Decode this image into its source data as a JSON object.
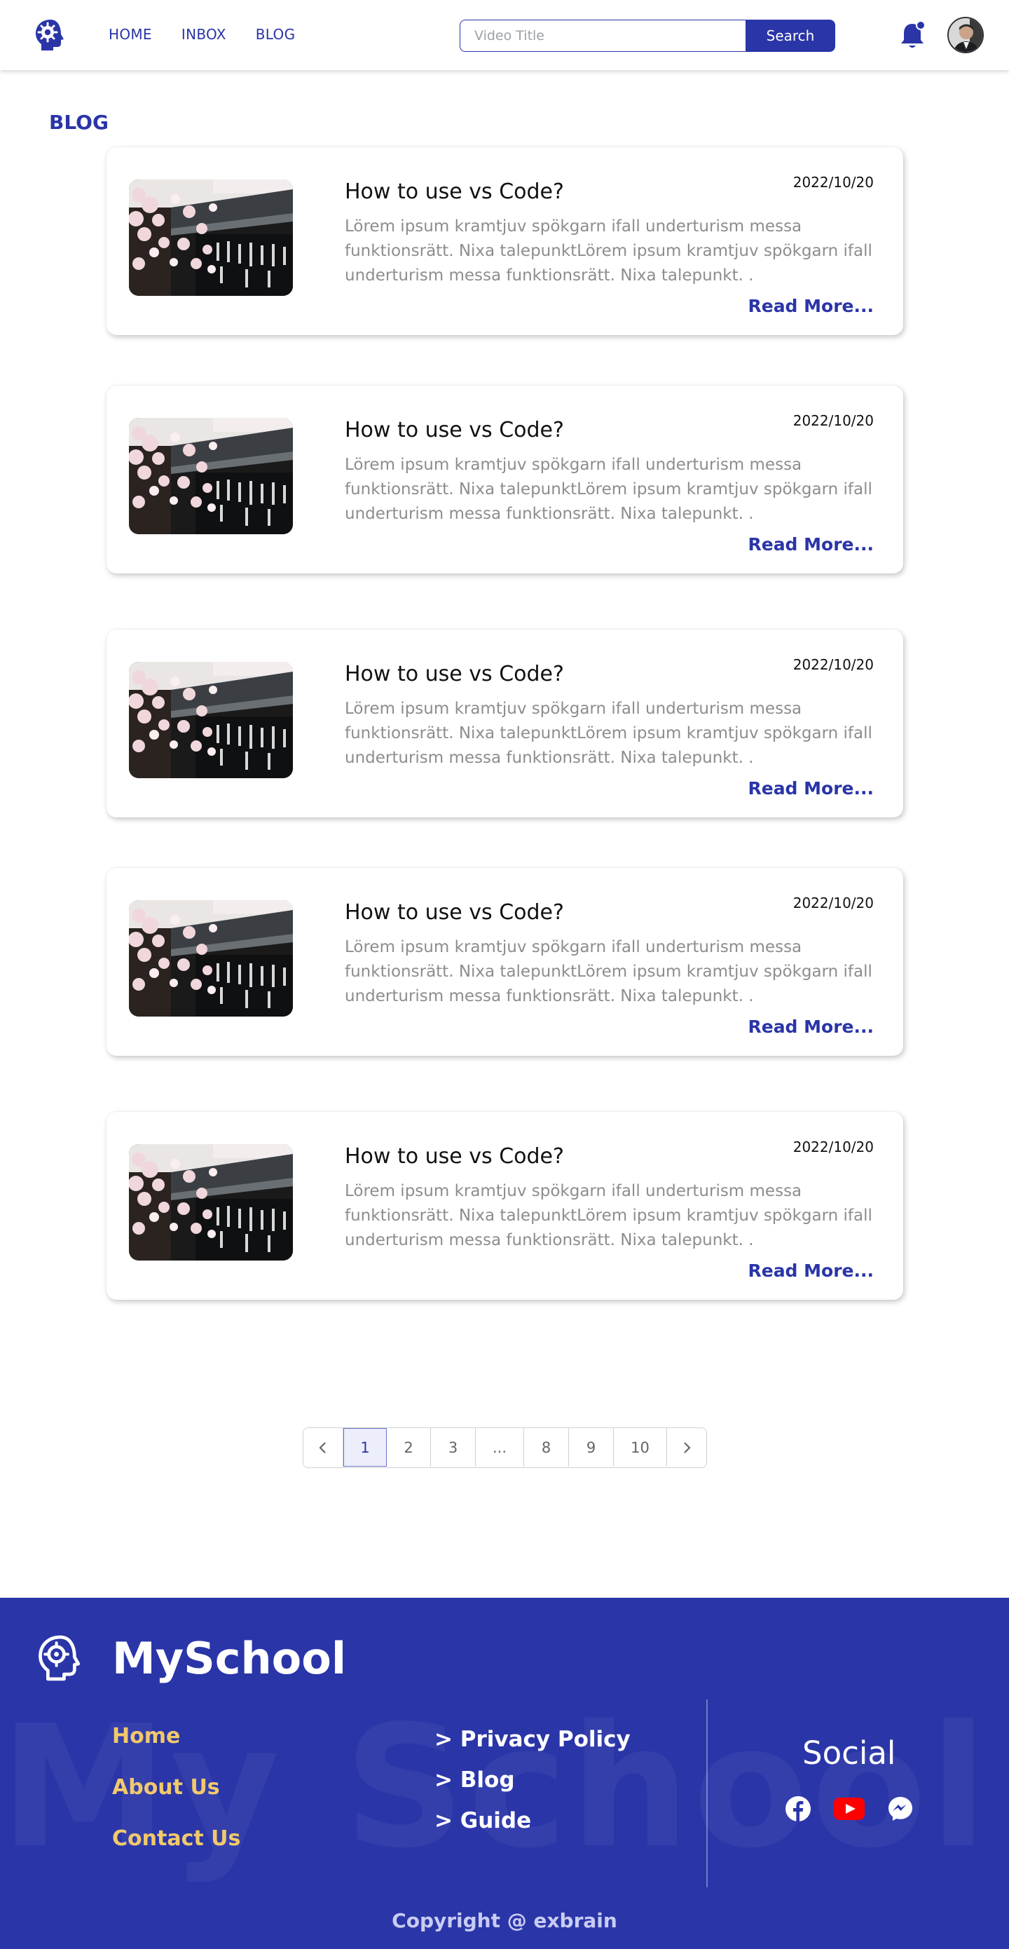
{
  "header": {
    "nav": [
      "HOME",
      "INBOX",
      "BLOG"
    ],
    "search_placeholder": "Video Title",
    "search_label": "Search"
  },
  "page": {
    "title": "BLOG"
  },
  "posts": [
    {
      "title": "How to use vs Code?",
      "date": "2022/10/20",
      "excerpt": "Lörem ipsum kramtjuv spökgarn ifall underturism messa funktionsrätt. Nixa talepunktLörem ipsum kramtjuv spökgarn ifall underturism messa funktionsrätt. Nixa talepunkt. .",
      "more": "Read More..."
    },
    {
      "title": "How to use vs Code?",
      "date": "2022/10/20",
      "excerpt": "Lörem ipsum kramtjuv spökgarn ifall underturism messa funktionsrätt. Nixa talepunktLörem ipsum kramtjuv spökgarn ifall underturism messa funktionsrätt. Nixa talepunkt. .",
      "more": "Read More..."
    },
    {
      "title": "How to use vs Code?",
      "date": "2022/10/20",
      "excerpt": "Lörem ipsum kramtjuv spökgarn ifall underturism messa funktionsrätt. Nixa talepunktLörem ipsum kramtjuv spökgarn ifall underturism messa funktionsrätt. Nixa talepunkt. .",
      "more": "Read More..."
    },
    {
      "title": "How to use vs Code?",
      "date": "2022/10/20",
      "excerpt": "Lörem ipsum kramtjuv spökgarn ifall underturism messa funktionsrätt. Nixa talepunktLörem ipsum kramtjuv spökgarn ifall underturism messa funktionsrätt. Nixa talepunkt. .",
      "more": "Read More..."
    },
    {
      "title": "How to use vs Code?",
      "date": "2022/10/20",
      "excerpt": "Lörem ipsum kramtjuv spökgarn ifall underturism messa funktionsrätt. Nixa talepunktLörem ipsum kramtjuv spökgarn ifall underturism messa funktionsrätt. Nixa talepunkt. .",
      "more": "Read More..."
    }
  ],
  "pagination": {
    "prev": "‹",
    "pages": [
      "1",
      "2",
      "3",
      "...",
      "8",
      "9",
      "10"
    ],
    "active": "1",
    "next": "›"
  },
  "footer": {
    "brand": "MySchool",
    "watermark": "My School",
    "links": [
      "Home",
      "About Us",
      "Contact Us"
    ],
    "links2": [
      "> Privacy Policy",
      "> Blog",
      "> Guide"
    ],
    "social_title": "Social",
    "social_icons": [
      "facebook-icon",
      "youtube-icon",
      "messenger-icon"
    ],
    "copyright": "Copyright @ exbrain"
  },
  "colors": {
    "brand": "#2a35a8",
    "footer_link": "#f2c96b",
    "youtube": "#ff0000"
  }
}
